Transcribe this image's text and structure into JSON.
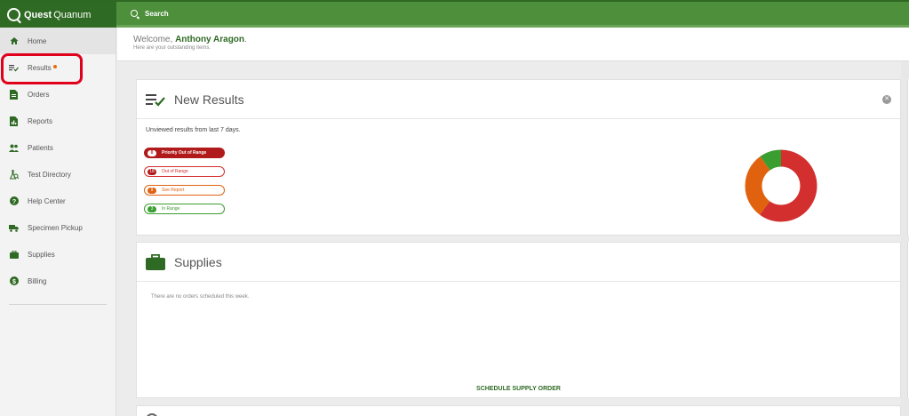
{
  "brand": {
    "name_bold": "Quest",
    "name_light": "Quanum"
  },
  "search": {
    "label": "Search"
  },
  "sidebar": {
    "items": [
      {
        "label": "Home",
        "icon": "home-icon"
      },
      {
        "label": "Results",
        "icon": "results-icon"
      },
      {
        "label": "Orders",
        "icon": "orders-icon"
      },
      {
        "label": "Reports",
        "icon": "reports-icon"
      },
      {
        "label": "Patients",
        "icon": "patients-icon"
      },
      {
        "label": "Test Directory",
        "icon": "test-directory-icon"
      },
      {
        "label": "Help Center",
        "icon": "help-icon"
      },
      {
        "label": "Specimen Pickup",
        "icon": "truck-icon"
      },
      {
        "label": "Supplies",
        "icon": "briefcase-icon"
      },
      {
        "label": "Billing",
        "icon": "dollar-icon"
      }
    ]
  },
  "welcome": {
    "greeting": "Welcome,",
    "user": "Anthony Aragon",
    "suffix": ".",
    "subtitle": "Here are your outstanding items."
  },
  "new_results": {
    "title": "New Results",
    "subtitle": "Unviewed results from last 7 days.",
    "categories": [
      {
        "count": "0",
        "label": "Priority Out of Range",
        "color": "#b11a1a"
      },
      {
        "count": "18",
        "label": "Out of Range",
        "color": "#d32f2f"
      },
      {
        "count": "9",
        "label": "See Report",
        "color": "#e0620f"
      },
      {
        "count": "3",
        "label": "In Range",
        "color": "#3a9d2f"
      }
    ]
  },
  "supplies": {
    "title": "Supplies",
    "empty_message": "There are no orders scheduled this week.",
    "schedule_label": "SCHEDULE SUPPLY ORDER"
  },
  "colors": {
    "brand_green": "#2f6a24",
    "accent_orange": "#e86b0a",
    "highlight_red": "#e0001b"
  }
}
